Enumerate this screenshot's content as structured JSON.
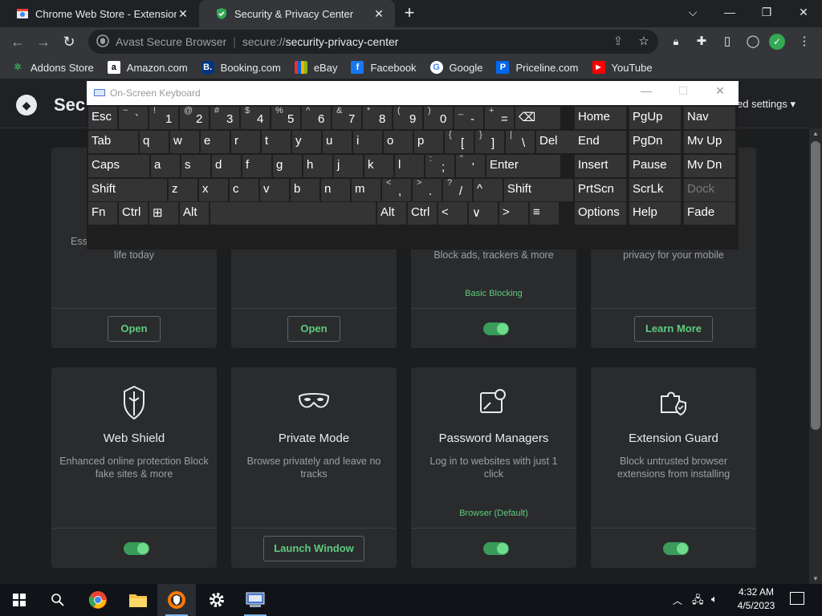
{
  "tabs": [
    {
      "title": "Chrome Web Store - Extensions",
      "active": false
    },
    {
      "title": "Security & Privacy Center",
      "active": true
    }
  ],
  "omnibox": {
    "brand": "Avast Secure Browser",
    "scheme": "secure://",
    "host": "security-privacy-center"
  },
  "bookmarks": [
    "Addons Store",
    "Amazon.com",
    "Booking.com",
    "eBay",
    "Facebook",
    "Google",
    "Priceline.com",
    "YouTube"
  ],
  "app": {
    "title": "Sec",
    "settings_label": "ed settings"
  },
  "cards_top": [
    {
      "desc": "life today",
      "desc_partial": "Ess",
      "button": "Open"
    },
    {
      "button": "Open"
    },
    {
      "desc": "Block ads, trackers & more",
      "status": "Basic Blocking",
      "toggle": "on"
    },
    {
      "desc": "privacy for your mobile",
      "button": "Learn More"
    }
  ],
  "cards_bottom": [
    {
      "title": "Web Shield",
      "desc": "Enhanced online protection Block fake sites & more",
      "toggle": "on",
      "icon": "shield-mask-icon"
    },
    {
      "title": "Private Mode",
      "desc": "Browse privately and leave no tracks",
      "button": "Launch Window",
      "icon": "mask-icon"
    },
    {
      "title": "Password Managers",
      "desc": "Log in to websites with just 1 click",
      "status": "Browser (Default)",
      "toggle": "on",
      "icon": "password-key-icon"
    },
    {
      "title": "Extension Guard",
      "desc": "Block untrusted browser extensions from installing",
      "toggle": "on",
      "icon": "puzzle-shield-icon"
    }
  ],
  "osk": {
    "title": "On-Screen Keyboard",
    "row1": [
      {
        "single": "Esc"
      },
      {
        "up": "~",
        "lo": "`"
      },
      {
        "up": "!",
        "lo": "1"
      },
      {
        "up": "@",
        "lo": "2"
      },
      {
        "up": "#",
        "lo": "3"
      },
      {
        "up": "$",
        "lo": "4"
      },
      {
        "up": "%",
        "lo": "5"
      },
      {
        "up": "^",
        "lo": "6"
      },
      {
        "up": "&",
        "lo": "7"
      },
      {
        "up": "*",
        "lo": "8"
      },
      {
        "up": "(",
        "lo": "9"
      },
      {
        "up": ")",
        "lo": "0"
      },
      {
        "up": "_",
        "lo": "-"
      },
      {
        "up": "+",
        "lo": "="
      },
      {
        "single": "⌫"
      }
    ],
    "row2": [
      {
        "single": "Tab"
      },
      {
        "single": "q"
      },
      {
        "single": "w"
      },
      {
        "single": "e"
      },
      {
        "single": "r"
      },
      {
        "single": "t"
      },
      {
        "single": "y"
      },
      {
        "single": "u"
      },
      {
        "single": "i"
      },
      {
        "single": "o"
      },
      {
        "single": "p"
      },
      {
        "up": "{",
        "lo": "["
      },
      {
        "up": "}",
        "lo": "]"
      },
      {
        "up": "|",
        "lo": "\\"
      },
      {
        "single": "Del"
      }
    ],
    "row3": [
      {
        "single": "Caps"
      },
      {
        "single": "a"
      },
      {
        "single": "s"
      },
      {
        "single": "d"
      },
      {
        "single": "f"
      },
      {
        "single": "g"
      },
      {
        "single": "h"
      },
      {
        "single": "j"
      },
      {
        "single": "k"
      },
      {
        "single": "l"
      },
      {
        "up": ":",
        "lo": ";"
      },
      {
        "up": "\"",
        "lo": "'"
      },
      {
        "single": "Enter"
      }
    ],
    "row4": [
      {
        "single": "Shift"
      },
      {
        "single": "z"
      },
      {
        "single": "x"
      },
      {
        "single": "c"
      },
      {
        "single": "v"
      },
      {
        "single": "b"
      },
      {
        "single": "n"
      },
      {
        "single": "m"
      },
      {
        "up": "<",
        "lo": ","
      },
      {
        "up": ">",
        "lo": "."
      },
      {
        "up": "?",
        "lo": "/"
      },
      {
        "single": "^"
      },
      {
        "single": "Shift"
      }
    ],
    "row5": [
      {
        "single": "Fn"
      },
      {
        "single": "Ctrl"
      },
      {
        "single": "⊞"
      },
      {
        "single": "Alt"
      },
      {
        "single": ""
      },
      {
        "single": "Alt"
      },
      {
        "single": "Ctrl"
      },
      {
        "single": "<"
      },
      {
        "single": "∨"
      },
      {
        "single": ">"
      },
      {
        "single": "≡"
      }
    ],
    "nav": [
      [
        "Home",
        "PgUp",
        "Nav"
      ],
      [
        "End",
        "PgDn",
        "Mv Up"
      ],
      [
        "Insert",
        "Pause",
        "Mv Dn"
      ],
      [
        "PrtScn",
        "ScrLk",
        "Dock"
      ],
      [
        "Options",
        "Help",
        "Fade"
      ]
    ]
  },
  "taskbar": {
    "time": "4:32 AM",
    "date": "4/5/2023"
  },
  "colors": {
    "accent_green": "#5ecb7e",
    "toggle_green": "#3a9b5a"
  }
}
